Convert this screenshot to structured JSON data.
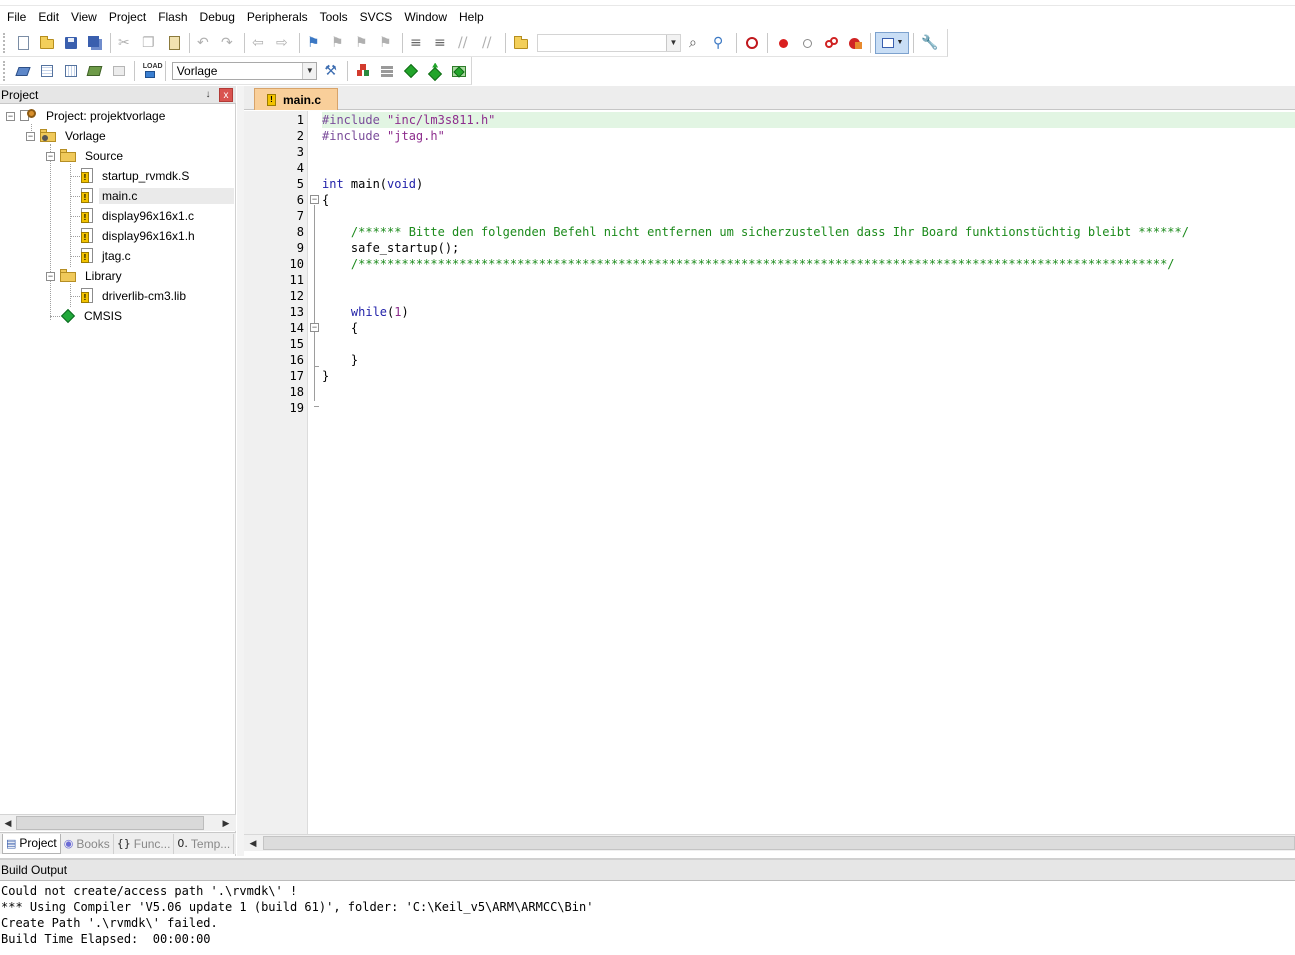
{
  "menu": [
    "File",
    "Edit",
    "View",
    "Project",
    "Flash",
    "Debug",
    "Peripherals",
    "Tools",
    "SVCS",
    "Window",
    "Help"
  ],
  "toolbar2": {
    "target_select": "Vorlage"
  },
  "project_panel": {
    "title": "Project",
    "pin": "↓",
    "close": "x",
    "tree": {
      "root": "Project: projektvorlage",
      "target": "Vorlage",
      "groups": [
        {
          "name": "Source",
          "files": [
            "startup_rvmdk.S",
            "main.c",
            "display96x16x1.c",
            "display96x16x1.h",
            "jtag.c"
          ]
        },
        {
          "name": "Library",
          "files": [
            "driverlib-cm3.lib"
          ]
        }
      ],
      "component": "CMSIS",
      "selected_file": "main.c"
    },
    "tabs": [
      {
        "label": "Project",
        "icon": "project-icon"
      },
      {
        "label": "Books",
        "icon": "books-icon"
      },
      {
        "label": "Func...",
        "icon": "functions-icon"
      },
      {
        "label": "Temp...",
        "icon": "templates-icon"
      }
    ]
  },
  "editor": {
    "tab_label": "main.c",
    "current_line": 1,
    "lines": [
      {
        "n": "1",
        "text": "#include \"inc/lm3s811.h\""
      },
      {
        "n": "2",
        "text": "#include \"jtag.h\""
      },
      {
        "n": "3",
        "text": ""
      },
      {
        "n": "4",
        "text": ""
      },
      {
        "n": "5",
        "text": "int main(void)"
      },
      {
        "n": "6",
        "text": "{"
      },
      {
        "n": "7",
        "text": ""
      },
      {
        "n": "8",
        "text": "    /****** Bitte den folgenden Befehl nicht entfernen um sicherzustellen dass Ihr Board funktionstüchtig bleibt ******/"
      },
      {
        "n": "9",
        "text": "    safe_startup();"
      },
      {
        "n": "10",
        "text": "    /****************************************************************************************************************/"
      },
      {
        "n": "11",
        "text": ""
      },
      {
        "n": "12",
        "text": ""
      },
      {
        "n": "13",
        "text": "    while(1)"
      },
      {
        "n": "14",
        "text": "    {"
      },
      {
        "n": "15",
        "text": ""
      },
      {
        "n": "16",
        "text": "    }"
      },
      {
        "n": "17",
        "text": "}"
      },
      {
        "n": "18",
        "text": ""
      },
      {
        "n": "19",
        "text": ""
      }
    ]
  },
  "build_output": {
    "title": "Build Output",
    "lines": [
      "Could not create/access path '.\\rvmdk\\' !",
      "*** Using Compiler 'V5.06 update 1 (build 61)', folder: 'C:\\Keil_v5\\ARM\\ARMCC\\Bin'",
      "Create Path '.\\rvmdk\\' failed.",
      "Build Time Elapsed:  00:00:00"
    ]
  },
  "colors": {
    "tab_active": "#f9cf9a",
    "current_line_bg": "#e2f5e3",
    "keyword": "#1f1fa8",
    "comment": "#1b8a1b",
    "string": "#8d2d8d"
  }
}
